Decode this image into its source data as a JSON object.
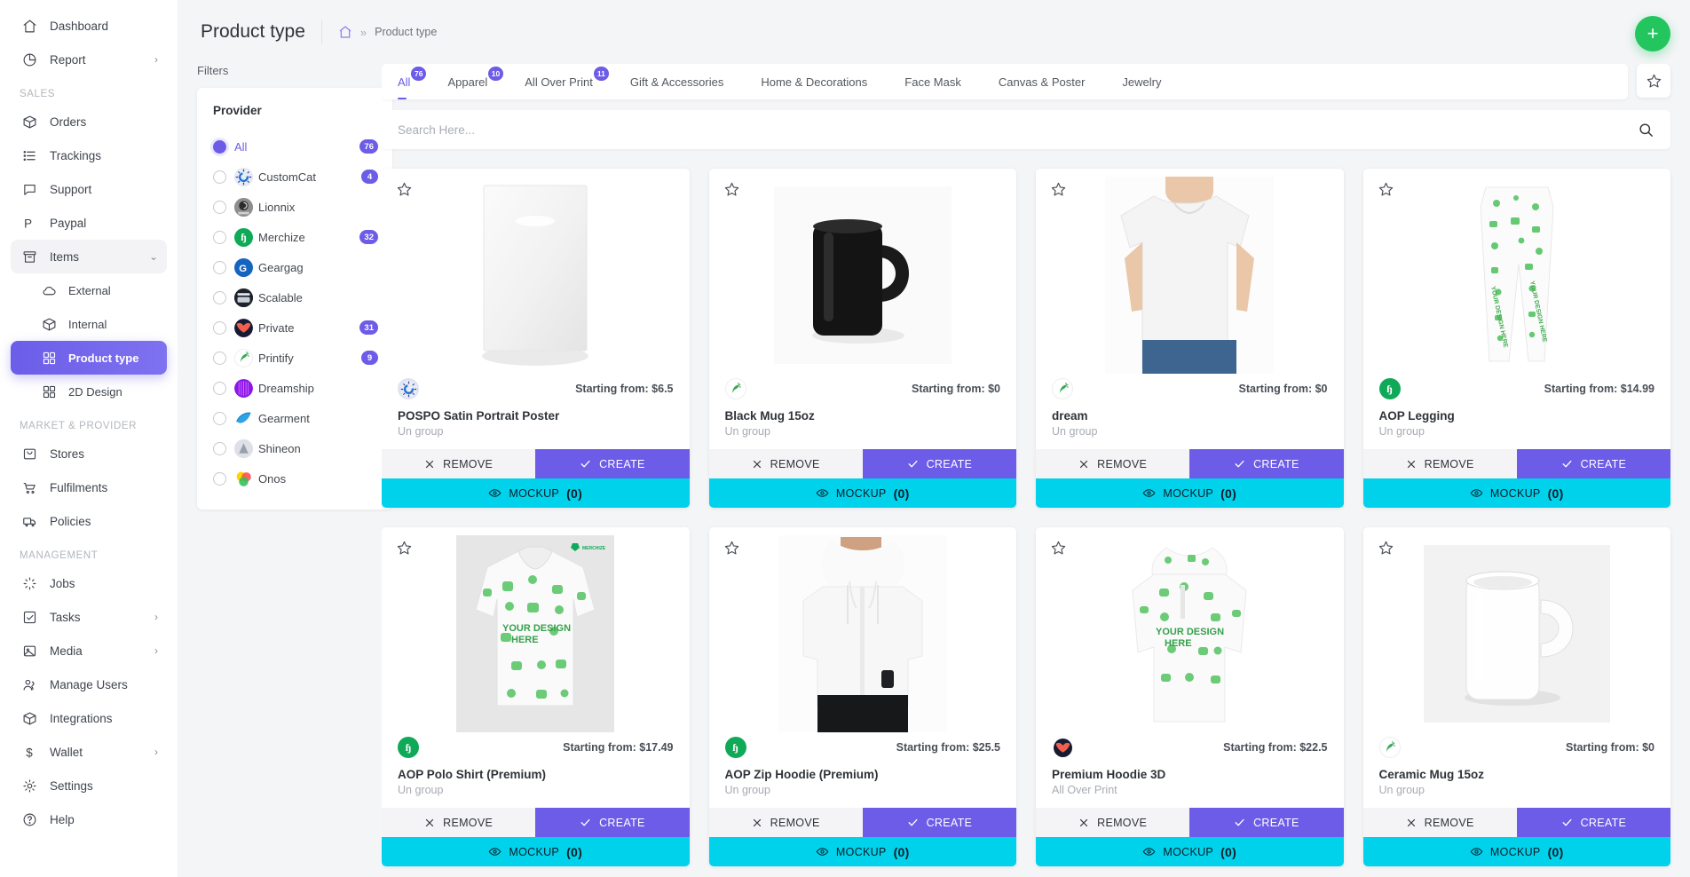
{
  "sidebar": {
    "items": [
      {
        "label": "Dashboard",
        "icon": "home-icon",
        "chevron": false,
        "state": "normal",
        "sub": false
      },
      {
        "label": "Report",
        "icon": "pie-chart-icon",
        "chevron": true,
        "state": "normal",
        "sub": false
      }
    ],
    "sections": [
      {
        "title": "SALES",
        "items": [
          {
            "label": "Orders",
            "icon": "box-icon",
            "chevron": false,
            "state": "normal",
            "sub": false
          },
          {
            "label": "Trackings",
            "icon": "list-icon",
            "chevron": false,
            "state": "normal",
            "sub": false
          },
          {
            "label": "Support",
            "icon": "chat-icon",
            "chevron": false,
            "state": "normal",
            "sub": false
          },
          {
            "label": "Paypal",
            "icon": "paypal-icon",
            "chevron": false,
            "state": "normal",
            "sub": false
          },
          {
            "label": "Items",
            "icon": "archive-icon",
            "chevron": true,
            "state": "expanded",
            "sub": false
          },
          {
            "label": "External",
            "icon": "cloud-icon",
            "chevron": false,
            "state": "normal",
            "sub": true
          },
          {
            "label": "Internal",
            "icon": "box-icon",
            "chevron": false,
            "state": "normal",
            "sub": true
          },
          {
            "label": "Product type",
            "icon": "grid-icon",
            "chevron": false,
            "state": "selected",
            "sub": true
          },
          {
            "label": "2D Design",
            "icon": "grid-icon",
            "chevron": false,
            "state": "normal",
            "sub": true
          }
        ]
      },
      {
        "title": "MARKET & PROVIDER",
        "items": [
          {
            "label": "Stores",
            "icon": "bag-icon",
            "chevron": false,
            "state": "normal",
            "sub": false
          },
          {
            "label": "Fulfilments",
            "icon": "cart-icon",
            "chevron": false,
            "state": "normal",
            "sub": false
          },
          {
            "label": "Policies",
            "icon": "truck-icon",
            "chevron": false,
            "state": "normal",
            "sub": false
          }
        ]
      },
      {
        "title": "MANAGEMENT",
        "items": [
          {
            "label": "Jobs",
            "icon": "spinner-icon",
            "chevron": false,
            "state": "normal",
            "sub": false
          },
          {
            "label": "Tasks",
            "icon": "check-square-icon",
            "chevron": true,
            "state": "normal",
            "sub": false
          },
          {
            "label": "Media",
            "icon": "image-icon",
            "chevron": true,
            "state": "normal",
            "sub": false
          },
          {
            "label": "Manage Users",
            "icon": "users-icon",
            "chevron": false,
            "state": "normal",
            "sub": false
          },
          {
            "label": "Integrations",
            "icon": "cube-icon",
            "chevron": false,
            "state": "normal",
            "sub": false
          },
          {
            "label": "Wallet",
            "icon": "dollar-icon",
            "chevron": true,
            "state": "normal",
            "sub": false
          },
          {
            "label": "Settings",
            "icon": "gear-icon",
            "chevron": false,
            "state": "normal",
            "sub": false
          },
          {
            "label": "Help",
            "icon": "help-icon",
            "chevron": false,
            "state": "normal",
            "sub": false
          }
        ]
      }
    ]
  },
  "header": {
    "title": "Product type",
    "breadcrumb_home": "home-icon",
    "breadcrumb_sep": "»",
    "breadcrumb_current": "Product type",
    "add_button_label": "+"
  },
  "filters": {
    "label": "Filters",
    "provider_heading": "Provider",
    "providers": [
      {
        "name": "All",
        "badge": "76",
        "selected": true,
        "logo": null
      },
      {
        "name": "CustomCat",
        "badge": "4",
        "selected": false,
        "logo": "customcat-logo"
      },
      {
        "name": "Lionnix",
        "badge": "",
        "selected": false,
        "logo": "lionnix-logo"
      },
      {
        "name": "Merchize",
        "badge": "32",
        "selected": false,
        "logo": "merchize-logo"
      },
      {
        "name": "Geargag",
        "badge": "",
        "selected": false,
        "logo": "geargag-logo"
      },
      {
        "name": "Scalable",
        "badge": "",
        "selected": false,
        "logo": "scalable-logo"
      },
      {
        "name": "Private",
        "badge": "31",
        "selected": false,
        "logo": "private-logo"
      },
      {
        "name": "Printify",
        "badge": "9",
        "selected": false,
        "logo": "printify-logo"
      },
      {
        "name": "Dreamship",
        "badge": "",
        "selected": false,
        "logo": "dreamship-logo"
      },
      {
        "name": "Gearment",
        "badge": "",
        "selected": false,
        "logo": "gearment-logo"
      },
      {
        "name": "Shineon",
        "badge": "",
        "selected": false,
        "logo": "shineon-logo"
      },
      {
        "name": "Onos",
        "badge": "",
        "selected": false,
        "logo": "onos-logo"
      }
    ]
  },
  "tabs": [
    {
      "label": "All",
      "badge": "76",
      "active": true
    },
    {
      "label": "Apparel",
      "badge": "10",
      "active": false
    },
    {
      "label": "All Over Print",
      "badge": "11",
      "active": false
    },
    {
      "label": "Gift & Accessories",
      "badge": "",
      "active": false
    },
    {
      "label": "Home & Decorations",
      "badge": "",
      "active": false
    },
    {
      "label": "Face Mask",
      "badge": "",
      "active": false
    },
    {
      "label": "Canvas & Poster",
      "badge": "",
      "active": false
    },
    {
      "label": "Jewelry",
      "badge": "",
      "active": false
    }
  ],
  "search": {
    "placeholder": "Search Here...",
    "value": "",
    "icon": "search-icon"
  },
  "buttons": {
    "remove_label": "REMOVE",
    "create_label": "CREATE",
    "mockup_label": "MOCKUP",
    "mockup_count": "(0)"
  },
  "products": [
    {
      "name": "POSPO Satin Portrait Poster",
      "group": "Un group",
      "price": "Starting from: $6.5",
      "provider": "customcat-logo",
      "thumb": "poster-thumb",
      "mockup": "(0)"
    },
    {
      "name": "Black Mug 15oz",
      "group": "Un group",
      "price": "Starting from: $0",
      "provider": "printify-logo",
      "thumb": "blackmug-thumb",
      "mockup": "(0)"
    },
    {
      "name": "dream",
      "group": "Un group",
      "price": "Starting from: $0",
      "provider": "printify-logo",
      "thumb": "tshirt-thumb",
      "mockup": "(0)"
    },
    {
      "name": "AOP Legging",
      "group": "Un group",
      "price": "Starting from: $14.99",
      "provider": "merchize-logo",
      "thumb": "legging-thumb",
      "mockup": "(0)"
    },
    {
      "name": "AOP Polo Shirt (Premium)",
      "group": "Un group",
      "price": "Starting from: $17.49",
      "provider": "merchize-logo",
      "thumb": "polo-thumb",
      "mockup": "(0)"
    },
    {
      "name": "AOP Zip Hoodie (Premium)",
      "group": "Un group",
      "price": "Starting from: $25.5",
      "provider": "merchize-logo",
      "thumb": "ziphoodie-thumb",
      "mockup": "(0)"
    },
    {
      "name": "Premium Hoodie 3D",
      "group": "All Over Print",
      "price": "Starting from: $22.5",
      "provider": "private-logo",
      "thumb": "hoodie3d-thumb",
      "mockup": "(0)"
    },
    {
      "name": "Ceramic Mug 15oz",
      "group": "Un group",
      "price": "Starting from: $0",
      "provider": "printify-logo",
      "thumb": "whitemug-thumb",
      "mockup": "(0)"
    }
  ],
  "colors": {
    "accent": "#6c5ce7",
    "mockup": "#00d2ec",
    "fab": "#22c55e",
    "merchize_green": "#0fa958"
  }
}
